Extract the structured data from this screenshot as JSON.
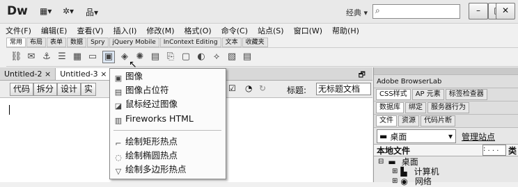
{
  "app": {
    "logo": "Dw",
    "layout_label": "经典",
    "search_placeholder": ""
  },
  "window_controls": [
    "–",
    "□",
    "✕"
  ],
  "menu": [
    "文件(F)",
    "编辑(E)",
    "查看(V)",
    "插入(I)",
    "修改(M)",
    "格式(O)",
    "命令(C)",
    "站点(S)",
    "窗口(W)",
    "帮助(H)"
  ],
  "insert_tabs": [
    "常用",
    "布局",
    "表单",
    "数据",
    "Spry",
    "jQuery Mobile",
    "InContext Editing",
    "文本",
    "收藏夹"
  ],
  "doc_tabs": [
    "Untitled-2",
    "Untitled-3"
  ],
  "view_buttons": [
    "代码",
    "拆分",
    "设计",
    "实"
  ],
  "title_label": "标题:",
  "title_value": "无标题文档",
  "dropdown": [
    {
      "label": "图像",
      "icon": "image-icon"
    },
    {
      "label": "图像占位符",
      "icon": "image-placeholder-icon"
    },
    {
      "label": "鼠标经过图像",
      "icon": "rollover-image-icon"
    },
    {
      "label": "Fireworks HTML",
      "icon": "fireworks-icon"
    },
    {
      "label": "绘制矩形热点",
      "icon": "rect-hotspot-icon"
    },
    {
      "label": "绘制椭圆热点",
      "icon": "oval-hotspot-icon"
    },
    {
      "label": "绘制多边形热点",
      "icon": "polygon-hotspot-icon"
    }
  ],
  "panels": {
    "browserlab": "Adobe BrowserLab",
    "row2": [
      "CSS样式",
      "AP 元素",
      "标签检查器"
    ],
    "row3": [
      "数据库",
      "绑定",
      "服务器行为"
    ],
    "row4": [
      "文件",
      "资源",
      "代码片断"
    ],
    "site_select": "桌面",
    "manage_sites": "管理站点",
    "file_header": "本地文件",
    "col2": "类",
    "tree": [
      "桌面",
      "计算机",
      "网络"
    ]
  }
}
